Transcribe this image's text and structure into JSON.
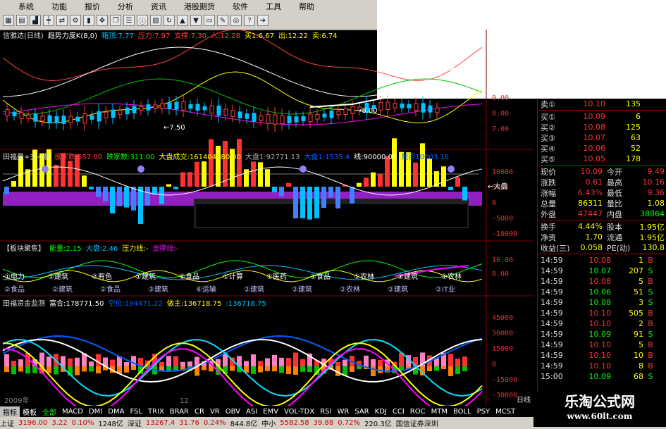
{
  "menu": [
    "系统",
    "功能",
    "报价",
    "分析",
    "资讯",
    "港股期货",
    "软件",
    "工具",
    "帮助"
  ],
  "toolbar_icons": [
    "grid-icon",
    "table-icon",
    "chart-icon",
    "k-line-icon",
    "compare-icon",
    "gear-icon",
    "bar-icon",
    "tools-icon",
    "window-icon",
    "list-icon",
    "info-icon",
    "news-icon",
    "refresh-icon",
    "up-icon",
    "down-icon",
    "select-icon",
    "pen-icon",
    "target-icon",
    "question-icon",
    "arrow-icon"
  ],
  "panel1": {
    "title": "信雅达(日线)",
    "items": [
      {
        "text": "趋势力度K(8,0)",
        "color": "#ffffff"
      },
      {
        "text": "箱顶:7.77",
        "color": "#00c0ff"
      },
      {
        "text": "压力:7.97",
        "color": "#ff4040"
      },
      {
        "text": "支撑:7.30",
        "color": "#ff4040"
      },
      {
        "text": "入:12.28",
        "color": "#ff4040"
      },
      {
        "text": "买1:6.67",
        "color": "#ffff00"
      },
      {
        "text": "出:12.22",
        "color": "#ffff00"
      },
      {
        "text": "卖:6.74",
        "color": "#ffff00"
      }
    ],
    "axis": [
      "9.00",
      "8.00",
      "7.00"
    ],
    "annot_left": "←7.50",
    "annot_right": "→8.00"
  },
  "panel2": {
    "title": "田福量+主+散",
    "items": [
      {
        "text": "涨家数:557.00",
        "color": "#ff4040"
      },
      {
        "text": "跌家数:311.00",
        "color": "#00ff00"
      },
      {
        "text": "大盘成交:161404080.00",
        "color": "#ffff00"
      },
      {
        "text": "大盘1:92771.13",
        "color": "#aaaaaa"
      },
      {
        "text": "大盘1:1535.4",
        "color": "#0060ff"
      },
      {
        "text": "线:90000.00",
        "color": "#ffffff"
      },
      {
        "text": "是否10003.16",
        "color": "#0060ff"
      }
    ],
    "axis": [
      "10000",
      "5000",
      "0",
      "-5000",
      "-10000"
    ],
    "annot": "←大盘"
  },
  "panel3": {
    "title": "【板块聚焦】",
    "items": [
      {
        "text": "能量:2.15",
        "color": "#00ff00"
      },
      {
        "text": "大盘:2.46",
        "color": "#00c0ff"
      },
      {
        "text": "压力线:-",
        "color": "#ffff00"
      },
      {
        "text": "支撑线:-",
        "color": "#ff00ff"
      }
    ],
    "axis": [
      "10.00",
      "8.00"
    ],
    "row1": [
      "①电力",
      "①建筑",
      "②有色",
      "①建筑",
      "②食品",
      "①计算",
      "①医药",
      "①食品",
      "①农林",
      "①建筑",
      "①农林"
    ],
    "row2": [
      "②食品",
      "②建筑",
      "②食品",
      "③建筑",
      "⑥运输",
      "②建筑",
      "②建筑",
      "②农林",
      "②建筑",
      "②IT业"
    ]
  },
  "panel4": {
    "title": "田福资金监测",
    "items": [
      {
        "text": "富合:178771.50",
        "color": "#ffffff"
      },
      {
        "text": "空位:194471.22",
        "color": "#0060ff"
      },
      {
        "text": "做主:136718.75",
        "color": "#ffff00"
      },
      {
        "text": ":136718.75",
        "color": "#00c0ff"
      }
    ],
    "axis": [
      "45000",
      "30000",
      "15000",
      "0",
      "-15000",
      "-30000"
    ],
    "x_labels": [
      "2009年",
      "12"
    ]
  },
  "quote": {
    "sell": [
      {
        "label": "卖①",
        "price": "10.10",
        "vol": "135"
      }
    ],
    "buy": [
      {
        "label": "买①",
        "price": "10.09",
        "vol": "6"
      },
      {
        "label": "买②",
        "price": "10.08",
        "vol": "125"
      },
      {
        "label": "买③",
        "price": "10.07",
        "vol": "63"
      },
      {
        "label": "买④",
        "price": "10.06",
        "vol": "52"
      },
      {
        "label": "买⑤",
        "price": "10.05",
        "vol": "178"
      }
    ],
    "stats": [
      {
        "a": "现价",
        "b": "10.09",
        "bc": "#ff3333",
        "c": "今开",
        "d": "9.49",
        "dc": "#ff3333"
      },
      {
        "a": "涨跌",
        "b": "0.61",
        "bc": "#ff3333",
        "c": "最高",
        "d": "10.16",
        "dc": "#ff3333"
      },
      {
        "a": "涨幅",
        "b": "6.43%",
        "bc": "#ff3333",
        "c": "最低",
        "d": "9.36",
        "dc": "#ff3333"
      },
      {
        "a": "总量",
        "b": "86311",
        "bc": "#ffff00",
        "c": "量比",
        "d": "1.08",
        "dc": "#ffff00"
      },
      {
        "a": "外盘",
        "b": "47447",
        "bc": "#ff3333",
        "c": "内盘",
        "d": "38864",
        "dc": "#00ff00"
      }
    ],
    "stats2": [
      {
        "a": "换手",
        "b": "4.44%",
        "c": "股本",
        "d": "1.95亿"
      },
      {
        "a": "净资",
        "b": "1.70",
        "c": "流通",
        "d": "1.95亿"
      },
      {
        "a": "收益(三)",
        "b": "0.058",
        "c": "PE(动)",
        "d": "130.8"
      }
    ],
    "ticks": [
      {
        "t": "14:59",
        "p": "10.08",
        "v": "1",
        "s": "B",
        "sc": "#ff3333"
      },
      {
        "t": "14:59",
        "p": "10.07",
        "v": "207",
        "s": "S",
        "sc": "#00ff00"
      },
      {
        "t": "14:59",
        "p": "10.08",
        "v": "5",
        "s": "B",
        "sc": "#ff3333"
      },
      {
        "t": "14:59",
        "p": "10.06",
        "v": "51",
        "s": "S",
        "sc": "#00ff00"
      },
      {
        "t": "14:59",
        "p": "10.08",
        "v": "3",
        "s": "S",
        "sc": "#00ff00"
      },
      {
        "t": "14:59",
        "p": "10.10",
        "v": "505",
        "s": "B",
        "sc": "#ff3333"
      },
      {
        "t": "14:59",
        "p": "10.10",
        "v": "2",
        "s": "B",
        "sc": "#ff3333"
      },
      {
        "t": "14:59",
        "p": "10.09",
        "v": "91",
        "s": "S",
        "sc": "#00ff00"
      },
      {
        "t": "14:59",
        "p": "10.10",
        "v": "5",
        "s": "B",
        "sc": "#ff3333"
      },
      {
        "t": "14:59",
        "p": "10.10",
        "v": "10",
        "s": "B",
        "sc": "#ff3333"
      },
      {
        "t": "14:59",
        "p": "10.10",
        "v": "8",
        "s": "B",
        "sc": "#ff3333"
      },
      {
        "t": "15:00",
        "p": "10.09",
        "v": "68",
        "s": "S",
        "sc": "#00ff00"
      }
    ],
    "footer": "日线"
  },
  "tabs": [
    "指标",
    "模板",
    "全部",
    "MACD",
    "DMI",
    "DMA",
    "FSL",
    "TRIX",
    "BRAR",
    "CR",
    "VR",
    "OBV",
    "ASI",
    "EMV",
    "VOL-TDX",
    "RSI",
    "WR",
    "SAR",
    "KDJ",
    "CCI",
    "ROC",
    "MTM",
    "BOLL",
    "PSY",
    "MCST"
  ],
  "status": [
    {
      "text": "上证",
      "color": "#000"
    },
    {
      "text": "3196.00",
      "color": "#cc0000"
    },
    {
      "text": "3.22",
      "color": "#cc0000"
    },
    {
      "text": "0.10%",
      "color": "#cc0000"
    },
    {
      "text": "1248亿",
      "color": "#000"
    },
    {
      "text": "深证",
      "color": "#000"
    },
    {
      "text": "13267.4",
      "color": "#cc0000"
    },
    {
      "text": "31.76",
      "color": "#cc0000"
    },
    {
      "text": "0.24%",
      "color": "#cc0000"
    },
    {
      "text": "844.8亿",
      "color": "#000"
    },
    {
      "text": "中小",
      "color": "#000"
    },
    {
      "text": "5582.58",
      "color": "#cc0000"
    },
    {
      "text": "39.88",
      "color": "#cc0000"
    },
    {
      "text": "0.72%",
      "color": "#cc0000"
    },
    {
      "text": "220.3亿",
      "color": "#000"
    },
    {
      "text": "国信证券深圳",
      "color": "#000"
    }
  ],
  "brand": {
    "name": "乐淘公式网",
    "url": "www.60lt.com"
  }
}
